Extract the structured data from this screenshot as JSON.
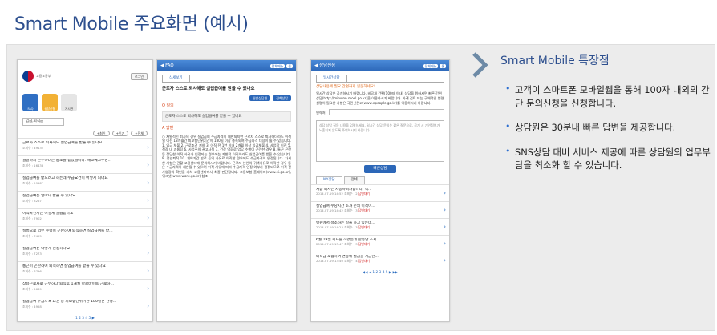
{
  "page": {
    "title": "Smart Mobile 주요화면 (예시)"
  },
  "features": {
    "title": "Smart Mobile 특장점",
    "items": [
      "고객이 스마트폰 모바일웹을 통해 100자 내외의 간단 문의신청을 신청합니다.",
      "상담원은 30분내 빠른 답변을 제공합니다.",
      "SNS상담 대비 서비스 제공에 따른 상담원의 업무부담을 최소화 할 수 있습니다."
    ]
  },
  "phone1": {
    "org": "고용노동부",
    "top_button": "로그인",
    "icons": [
      "FAQ",
      "상담신청",
      "게시판"
    ],
    "search": "임금,퇴직금",
    "tabs": [
      "+최신",
      "+인기",
      "+전체"
    ],
    "items": [
      {
        "t": "근로자 스스로 퇴사해도 실업급여를 받을 수 있나요",
        "m": "조회수 : 49135"
      },
      {
        "t": "월말까지 근무하려는 통보를 받았습니다. 해고예고수당...",
        "m": "조회수 : 16438"
      },
      {
        "t": "실업급여를 받으려고 하는데 수급요건이 어떻게 되나요",
        "m": "조회수 : 10987"
      },
      {
        "t": "실업급여는 얼마나 받을 수 있나요",
        "m": "조회수 : 8267"
      },
      {
        "t": "이직확인서는 어떻게 발급받나요",
        "m": "조회수 : 7902"
      },
      {
        "t": "질병으로 업무 수행이 곤란하여 퇴직하면 실업급여를 받...",
        "m": "조회수 : 7495"
      },
      {
        "t": "실업급여는 어떻게 신청하나요",
        "m": "조회수 : 7273"
      },
      {
        "t": "통근이 곤란하여 퇴직하면 실업급여를 받을 수 있나요",
        "m": "조회수 : 6796"
      },
      {
        "t": "상용근로자로 근무하다 퇴직후 1개월 아르바이트 근로하...",
        "m": "조회수 : 5689"
      },
      {
        "t": "실업급여 수급자격 요건 중 피보험단위기간 180일은 산정...",
        "m": "조회수 : 4958"
      }
    ],
    "pager": "1 2 3 4 5 ▶"
  },
  "phone2": {
    "header": "FAQ",
    "header_buttons": [
      "전체메뉴",
      "홈"
    ],
    "subtab": "상세보기",
    "question_title": "근로자 스스로 퇴사해도 실업급여를 받을 수 있나요",
    "buttons": [
      "일반상담원",
      "전화상담"
    ],
    "q_label": "질의",
    "question": "근로자 스스로 퇴사해도 실업급여를 받을 수 있나요",
    "a_label": "답변",
    "answer": "○ 자발적인 퇴사의 경우 실업급여 수급자격이 제한되지만 근로자 스스로 퇴사하더라도 이직일 이전 18개월간 피보험단위기간이 180일 이상 충족되며 수급자격 대상이 될 수 있습니다. 1. 임금 체불 2. 근로조건 저하 3. 이직 전 1년 이내 2개월 이상 임금체불 4. 사업장 이전 5. 직장 내 괴롭힘 6. 사업주의 권고사직 7. 건강 악화로 업무 수행이 곤란한 경우 8. 통근 곤란 등 정당한 이직 사유가 인정되는 경우에는 자발적 이직이라도 실업급여를 받을 수 있습니다. 9. 정년퇴직 10. 계약기간 만료 등의 사유로 이직한 경우에도 수급자격이 인정됩니다. 자세한 사항은 관할 고용센터에 문의하시기 바랍니다. 근로자 본인의 귀책사유로 이직한 경우 등은 수급자격이 제한될 수 있으며 이직 사유에 따라 수급자격 인정 여부가 결정되므로 이직 전 사업장의 확인을 거쳐 고용센터에서 최종 판단합니다. 고용보험 홈페이지(www.ei.go.kr), 워크넷(www.work.go.kr) 참조"
  },
  "phone3": {
    "header": "상담신청",
    "header_buttons": [
      "전체메뉴",
      "홈"
    ],
    "subtab": "일시간상담",
    "notice": "상담내용에 필요 간편하게 질문하세요!",
    "desc": "일시간 상담은 공개하시기 바랍니다. 비공개 간편(100자 이내) 상담을 원하시면 빠른 간편 상담(http://minwon.moel.go.kr)을 이용하시기 바랍니다. 사례 검토 또는 구체적인 법령 설명이 필요한 사항은 국민신문고(www.epeople.go.kr)를 이용하시기 바랍니다.",
    "contact_label": "연락처",
    "textarea_placeholder": "상담 상담 질문 내용을 입력하세요. 일시간 상담 문의는 짧은 질문으로, 공개 시 개인정보가 노출되지 않도록 주의하시기 바랍니다.",
    "send_button": "빠른상담",
    "tabs": [
      "MY상담",
      "전체"
    ],
    "items": [
      {
        "t": "처음 회사는 자동차회사입니다. 적...",
        "m": "2014.07.19 14:52  조회수 : 2",
        "s": "답변대기"
      },
      {
        "t": "실업급여 수당시간 초과 문의 이직이...",
        "m": "2014.07.19 14:42  조회수 : 3",
        "s": "답변대기"
      },
      {
        "t": "병원에서 청소하는 일을 하고 있는데...",
        "m": "2014.07.19 14:23  조회수 : 3",
        "s": "답변대기"
      },
      {
        "t": "6월 19일 회사를 하였는데 한동안 조지...",
        "m": "2014.07.19 13:47  조회수 : 3",
        "s": "답변대기"
      },
      {
        "t": "퇴직금 포함하여 연봉에 월급을 지급한...",
        "m": "2014.07.19 13:40  조회수 : 4",
        "s": "답변대기"
      }
    ],
    "pager": "◀◀ ◀ 1 2 3 4 5 ▶ ▶▶"
  }
}
